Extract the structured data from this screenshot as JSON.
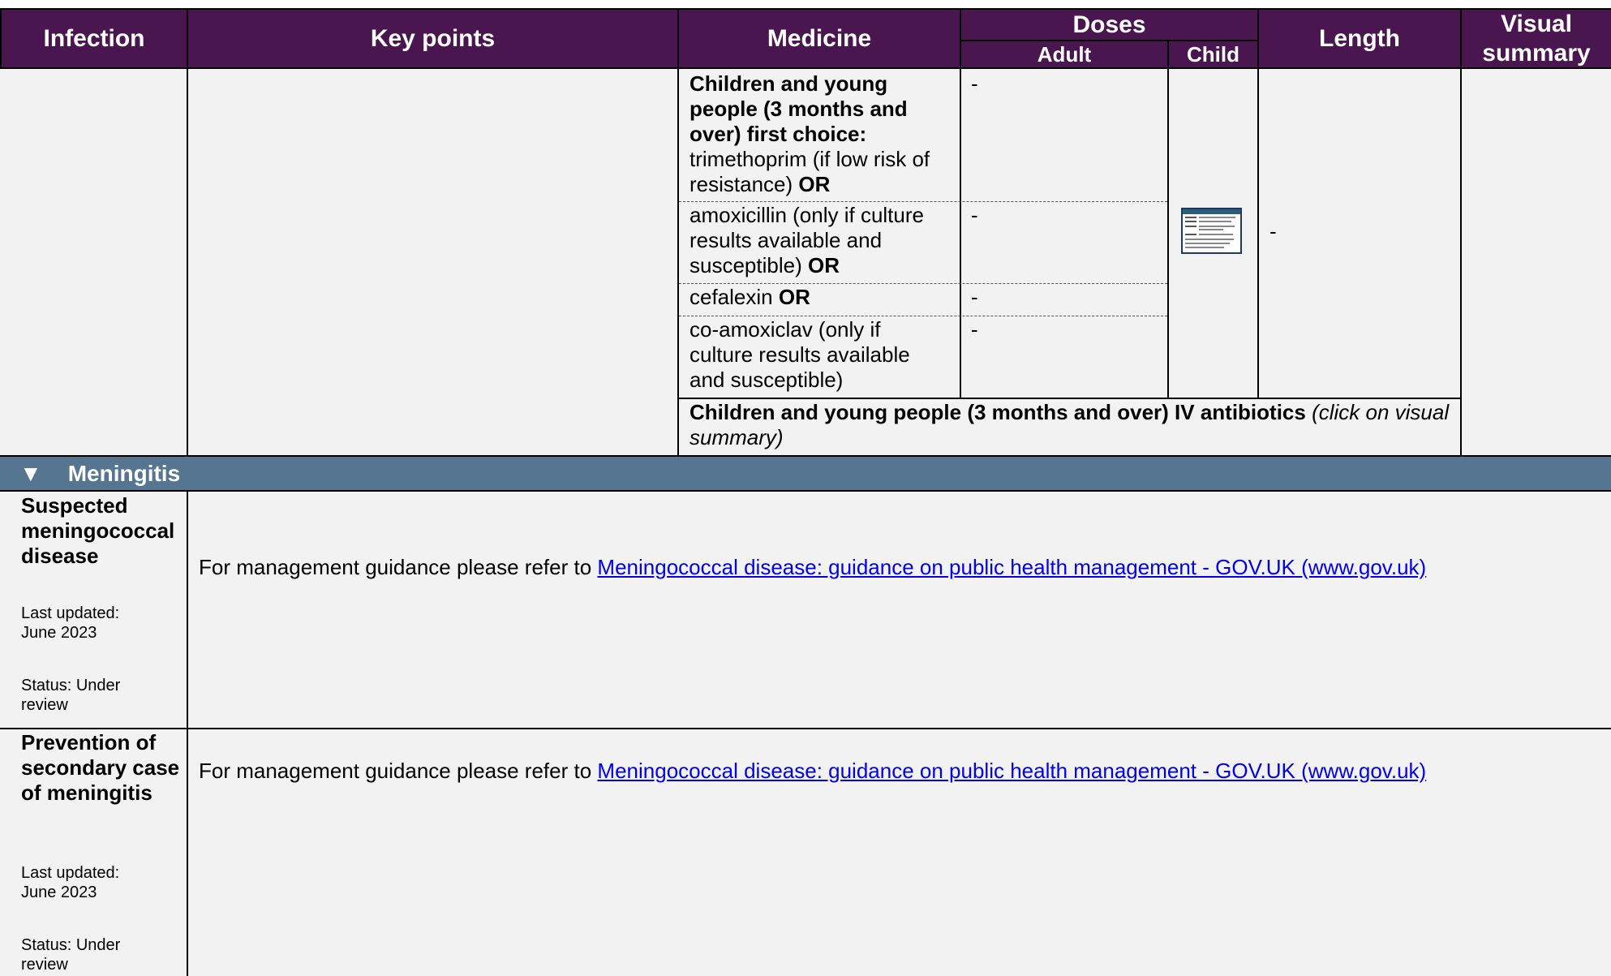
{
  "header": {
    "infection": "Infection",
    "key_points": "Key points",
    "medicine": "Medicine",
    "doses": "Doses",
    "adult": "Adult",
    "child": "Child",
    "length": "Length",
    "visual_line1": "Visual",
    "visual_line2": "summary"
  },
  "uti_rows": {
    "row1_bold": "Children and young people (3 months and over) first choice:",
    "row1_text": "trimethoprim (if low risk of resistance)",
    "row1_or": "OR",
    "row1_adult": "-",
    "row2_text": "amoxicillin (only if culture results available and susceptible)",
    "row2_or": "OR",
    "row2_adult": "-",
    "row3_text": "cefalexin",
    "row3_or": "OR",
    "row3_adult": "-",
    "row4_text": "co-amoxiclav (only if culture results available and susceptible)",
    "row4_adult": "-",
    "length_value": "-",
    "iv_bold": "Children and young people (3 months and over) IV antibiotics",
    "iv_italic": "(click on visual summary)",
    "child_thumbnail_icon": "visual-summary-thumbnail-icon"
  },
  "section": {
    "arrow": "▼",
    "title": "Meningitis"
  },
  "rows": [
    {
      "title": "Suspected meningococcal disease",
      "updated": "Last updated: June 2023",
      "status": "Status: Under review",
      "guidance_prefix": "For management guidance please refer to",
      "link_text": "Meningococcal disease: guidance on public health management - GOV.UK (www.gov.uk)"
    },
    {
      "title": "Prevention of secondary case of meningitis",
      "updated": "Last updated: June 2023",
      "status": "Status: Under review",
      "guidance_prefix": "For management guidance please refer to",
      "link_text": "Meningococcal disease: guidance on public health management - GOV.UK (www.gov.uk)"
    }
  ],
  "colors": {
    "header_bg": "#4a1650",
    "section_bg": "#557590",
    "cell_bg": "#f2f2f2",
    "link": "#0000ee"
  }
}
